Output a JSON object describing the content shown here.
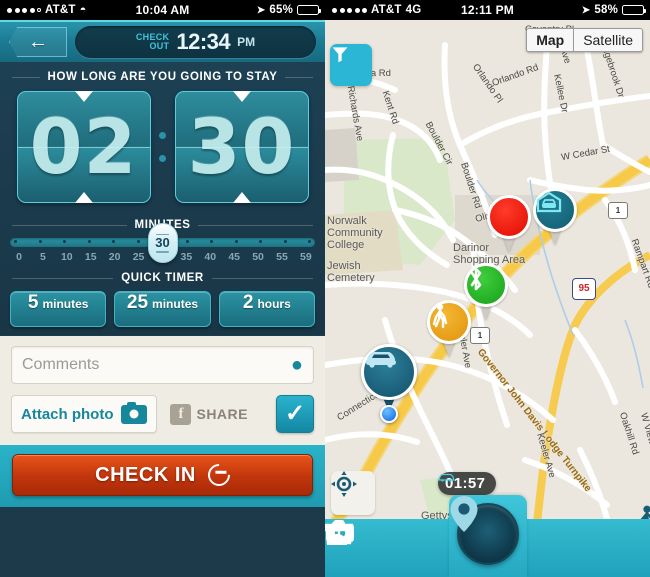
{
  "left": {
    "statusbar": {
      "carrier": "AT&T",
      "network": "",
      "time": "10:04 AM",
      "battery": "65%",
      "wifi_icon": "wifi-icon",
      "location_icon": "location-arrow-icon"
    },
    "header": {
      "back_icon": "back-arrow-icon",
      "checkout_label_line1": "CHECK",
      "checkout_label_line2": "OUT",
      "checkout_time": "12:34",
      "checkout_ampm": "PM"
    },
    "duration": {
      "title": "HOW LONG ARE YOU GOING TO STAY",
      "hours": "02",
      "minutes": "30",
      "up_icon": "triangle-up-icon",
      "down_icon": "triangle-down-icon"
    },
    "minutes_slider": {
      "title": "MINUTES",
      "value": "30",
      "ticks": [
        "0",
        "5",
        "10",
        "15",
        "20",
        "25",
        "30",
        "35",
        "40",
        "45",
        "50",
        "55",
        "59"
      ],
      "labels": [
        "0",
        "5",
        "10",
        "15",
        "20",
        "25",
        "35",
        "40",
        "45",
        "50",
        "55",
        "59"
      ]
    },
    "quick_timer": {
      "title": "QUICK TIMER",
      "options": [
        {
          "number": "5",
          "unit": "minutes"
        },
        {
          "number": "25",
          "unit": "minutes"
        },
        {
          "number": "2",
          "unit": "hours"
        }
      ]
    },
    "form": {
      "comments_placeholder": "Comments",
      "comments_value": "",
      "pin_icon": "map-pin-icon",
      "attach_label": "Attach photo",
      "camera_icon": "camera-icon",
      "facebook_icon": "facebook-icon",
      "share_label": "SHARE",
      "check_icon": "checkmark-icon"
    },
    "footer": {
      "checkin_label": "CHECK IN",
      "checkin_icon": "check-in-arrow-icon"
    }
  },
  "right": {
    "statusbar": {
      "carrier": "AT&T",
      "network": "4G",
      "time": "12:11 PM",
      "battery": "58%",
      "location_icon": "location-arrow-icon"
    },
    "map_toggle": {
      "map_label": "Map",
      "satellite_label": "Satellite",
      "active": "Map"
    },
    "filter_button": {
      "icon": "filter-funnel-icon"
    },
    "timer_badge": {
      "icon": "car-icon",
      "value": "01:57"
    },
    "locate_button": {
      "icon": "crosshair-icon"
    },
    "walk_button": {
      "icon": "pedestrian-icon"
    },
    "pins": [
      {
        "name": "selected-location-pin",
        "icon": "red-dot-icon",
        "color": "#e00b00"
      },
      {
        "name": "garage-pin",
        "icon": "garage-car-icon",
        "color": "#1f7f94"
      },
      {
        "name": "bluetooth-pin",
        "icon": "bluetooth-icon",
        "color": "#17a017"
      },
      {
        "name": "pedestrian-pin",
        "icon": "pedestrian-icon",
        "color": "#e09310"
      },
      {
        "name": "my-car-pin",
        "icon": "car-icon",
        "color": "#14516b"
      }
    ],
    "map_labels": {
      "roads": [
        "Coventry Pl",
        "Orlando Rd",
        "Orlando Pl",
        "scilla Rd",
        "Richards Ave",
        "Boulder Cir",
        "Boulder Rd",
        "Kent Rd",
        "Kellee Dr",
        "Ledgebrook Dr",
        "W Cedar St",
        "Olive St",
        "Keeler Ave",
        "Connecticut Ave",
        "Governor John Davis Lodge Turnpike",
        "Rampart Rd",
        "Oakhill Rd",
        "W View Ave",
        "Ave"
      ],
      "places": [
        "Norwalk Community College",
        "Jewish Cemetery",
        "Darinor Shopping Area",
        "Gettys Farm"
      ],
      "shields": [
        "1",
        "1",
        "95"
      ]
    },
    "tabbar": {
      "items": [
        {
          "name": "settings-tab",
          "icon": "gear-icon"
        },
        {
          "name": "camera-tab",
          "icon": "camera-icon"
        },
        {
          "name": "center-pin-tab",
          "icon": "map-pin-icon"
        },
        {
          "name": "rewards-tab",
          "icon": "gift-icon"
        },
        {
          "name": "profile-tab",
          "icon": "person-icon"
        }
      ]
    }
  },
  "colors": {
    "teal": "#2ab3c8",
    "dark_teal": "#1c3a4a",
    "orange_button": "#c1350c",
    "cyan_accent": "#2ab6d4",
    "map_bg": "#ebe7de",
    "highway_yellow": "#f7c948"
  }
}
